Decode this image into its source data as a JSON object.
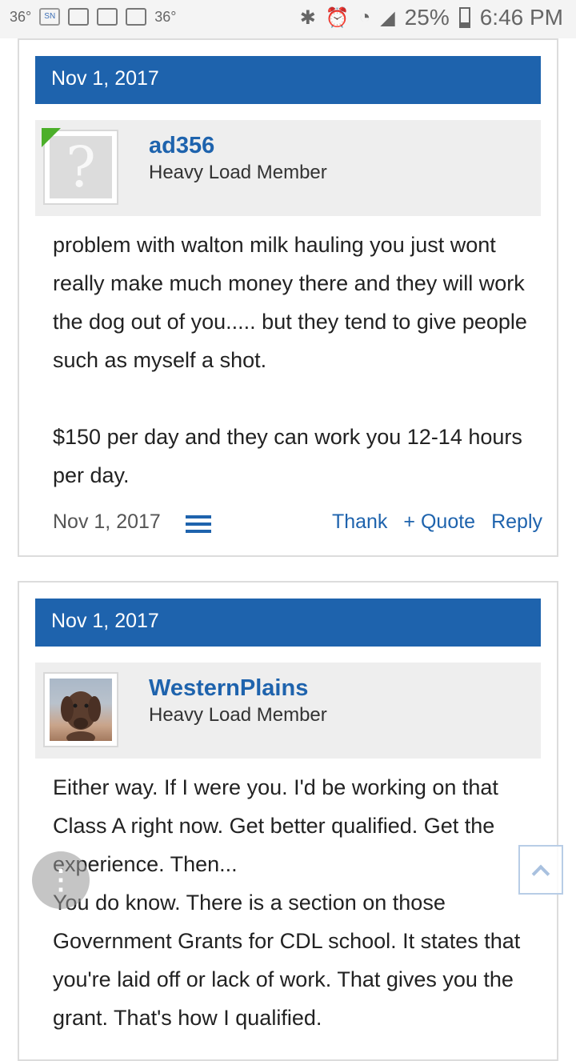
{
  "status_bar": {
    "left_items": [
      "36°",
      "36°"
    ],
    "battery": "25%",
    "time": "6:46 PM"
  },
  "posts": [
    {
      "date_header": "Nov 1, 2017",
      "username": "ad356",
      "user_title": "Heavy Load Member",
      "body": [
        "problem with walton milk hauling you just wont really make much money there and they will work the dog out of you..... but they tend to give people such as myself a shot.",
        "$150 per day and they can work you 12-14 hours per day."
      ],
      "footer_date": "Nov 1, 2017",
      "actions": {
        "thank": "Thank",
        "quote": "+ Quote",
        "reply": "Reply"
      }
    },
    {
      "date_header": "Nov 1, 2017",
      "username": "WesternPlains",
      "user_title": "Heavy Load Member",
      "body": [
        "Either way. If I were you. I'd be working on that Class A right now. Get better qualified. Get the experience. Then...",
        "You do know. There is a section on those Government Grants for CDL school. It states that you're laid off or lack of work. That gives you the grant. That's how I qualified."
      ]
    }
  ],
  "icons": {
    "avatar_placeholder": "?",
    "more_menu": "⋮"
  }
}
